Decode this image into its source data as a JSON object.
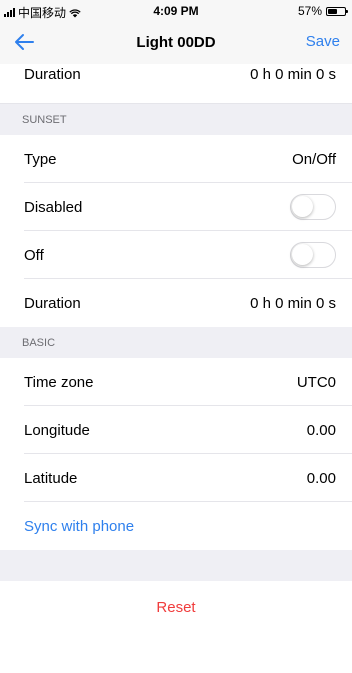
{
  "status_bar": {
    "carrier": "中国移动",
    "time": "4:09 PM",
    "battery_text": "57%",
    "battery_level": 0.57,
    "icons": [
      "signal-icon",
      "wifi-icon",
      "battery-icon"
    ]
  },
  "nav": {
    "back_icon": "back-arrow-icon",
    "title": "Light 00DD",
    "save_label": "Save"
  },
  "top_row": {
    "label": "Duration",
    "value": "0 h 0 min 0 s"
  },
  "sunset": {
    "header": "SUNSET",
    "rows": [
      {
        "label": "Type",
        "value": "On/Off"
      },
      {
        "label": "Disabled",
        "toggle_on": false
      },
      {
        "label": "Off",
        "toggle_on": false
      },
      {
        "label": "Duration",
        "value": "0 h 0 min 0 s"
      }
    ]
  },
  "basic": {
    "header": "BASIC",
    "rows": [
      {
        "label": "Time zone",
        "value": "UTC0"
      },
      {
        "label": "Longitude",
        "value": "0.00"
      },
      {
        "label": "Latitude",
        "value": "0.00"
      }
    ],
    "sync_label": "Sync with phone"
  },
  "reset_label": "Reset",
  "colors": {
    "accent": "#2f80ed",
    "danger": "#f03c3c",
    "background": "#efeff4"
  }
}
